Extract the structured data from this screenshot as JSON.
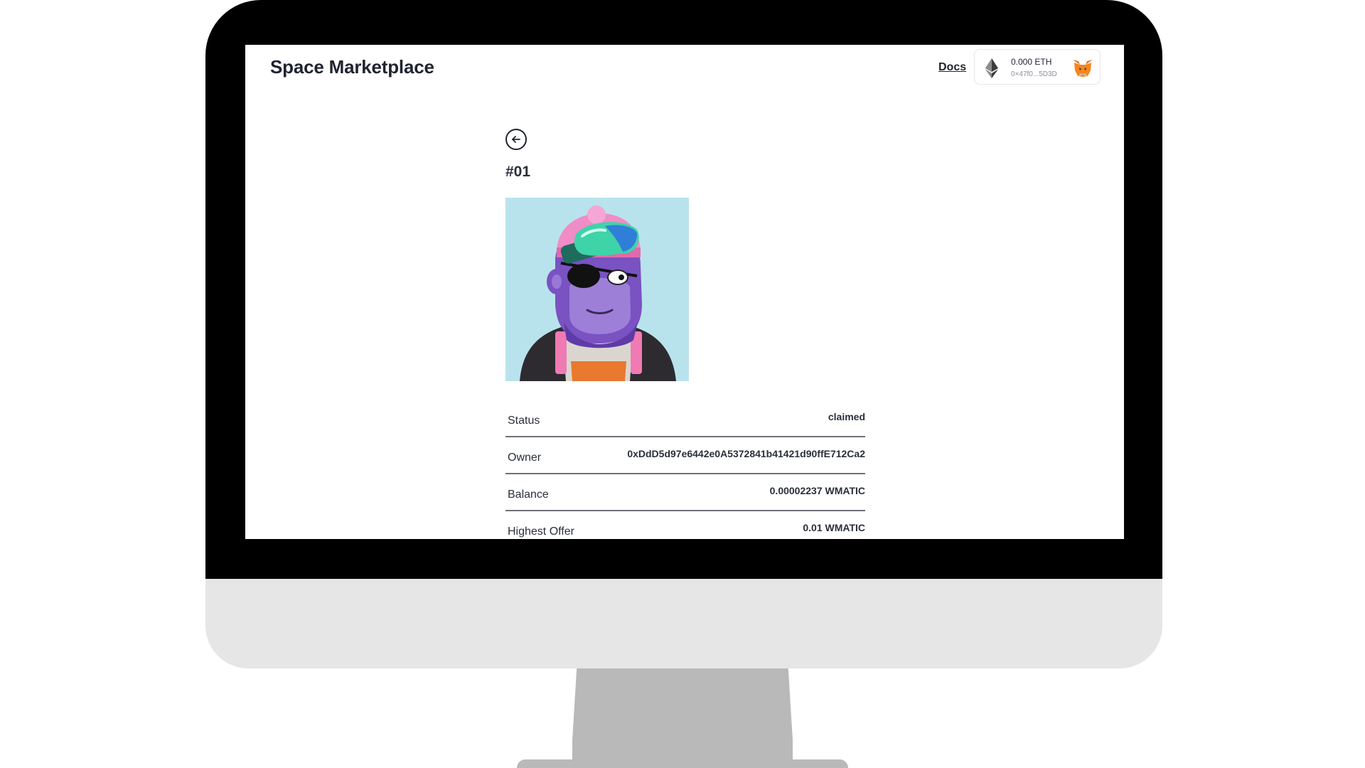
{
  "app": {
    "title": "Space Marketplace",
    "docs_label": "Docs"
  },
  "wallet": {
    "balance": "0.000 ETH",
    "address": "0×47f0...5D3D",
    "currency_icon": "ethereum-icon",
    "wallet_icon": "metamask-fox-icon"
  },
  "detail": {
    "back_icon": "arrow-left-circle-icon",
    "item_id": "#01",
    "image_alt": "nft-ape-artwork",
    "rows": [
      {
        "label": "Status",
        "value": "claimed"
      },
      {
        "label": "Owner",
        "value": "0xDdD5d97e6442e0A5372841b41421d90ffE712Ca2"
      },
      {
        "label": "Balance",
        "value": "0.00002237 WMATIC"
      },
      {
        "label": "Highest Offer",
        "value": "0.01 WMATIC"
      }
    ]
  },
  "colors": {
    "frame": "#000000",
    "chin": "#e6e6e6",
    "stand": "#b9b9b9",
    "nft_background": "#b9e3ec",
    "text": "#1f2430"
  }
}
